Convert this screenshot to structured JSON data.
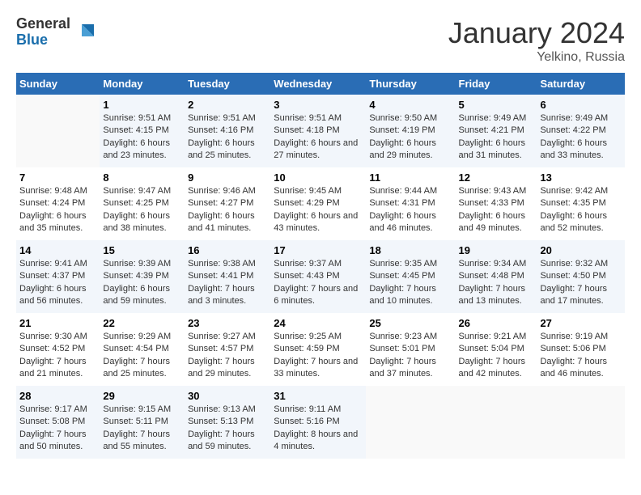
{
  "logo": {
    "general": "General",
    "blue": "Blue"
  },
  "title": "January 2024",
  "subtitle": "Yelkino, Russia",
  "days_header": [
    "Sunday",
    "Monday",
    "Tuesday",
    "Wednesday",
    "Thursday",
    "Friday",
    "Saturday"
  ],
  "weeks": [
    [
      {
        "day": "",
        "sunrise": "",
        "sunset": "",
        "daylight": ""
      },
      {
        "day": "1",
        "sunrise": "Sunrise: 9:51 AM",
        "sunset": "Sunset: 4:15 PM",
        "daylight": "Daylight: 6 hours and 23 minutes."
      },
      {
        "day": "2",
        "sunrise": "Sunrise: 9:51 AM",
        "sunset": "Sunset: 4:16 PM",
        "daylight": "Daylight: 6 hours and 25 minutes."
      },
      {
        "day": "3",
        "sunrise": "Sunrise: 9:51 AM",
        "sunset": "Sunset: 4:18 PM",
        "daylight": "Daylight: 6 hours and 27 minutes."
      },
      {
        "day": "4",
        "sunrise": "Sunrise: 9:50 AM",
        "sunset": "Sunset: 4:19 PM",
        "daylight": "Daylight: 6 hours and 29 minutes."
      },
      {
        "day": "5",
        "sunrise": "Sunrise: 9:49 AM",
        "sunset": "Sunset: 4:21 PM",
        "daylight": "Daylight: 6 hours and 31 minutes."
      },
      {
        "day": "6",
        "sunrise": "Sunrise: 9:49 AM",
        "sunset": "Sunset: 4:22 PM",
        "daylight": "Daylight: 6 hours and 33 minutes."
      }
    ],
    [
      {
        "day": "7",
        "sunrise": "Sunrise: 9:48 AM",
        "sunset": "Sunset: 4:24 PM",
        "daylight": "Daylight: 6 hours and 35 minutes."
      },
      {
        "day": "8",
        "sunrise": "Sunrise: 9:47 AM",
        "sunset": "Sunset: 4:25 PM",
        "daylight": "Daylight: 6 hours and 38 minutes."
      },
      {
        "day": "9",
        "sunrise": "Sunrise: 9:46 AM",
        "sunset": "Sunset: 4:27 PM",
        "daylight": "Daylight: 6 hours and 41 minutes."
      },
      {
        "day": "10",
        "sunrise": "Sunrise: 9:45 AM",
        "sunset": "Sunset: 4:29 PM",
        "daylight": "Daylight: 6 hours and 43 minutes."
      },
      {
        "day": "11",
        "sunrise": "Sunrise: 9:44 AM",
        "sunset": "Sunset: 4:31 PM",
        "daylight": "Daylight: 6 hours and 46 minutes."
      },
      {
        "day": "12",
        "sunrise": "Sunrise: 9:43 AM",
        "sunset": "Sunset: 4:33 PM",
        "daylight": "Daylight: 6 hours and 49 minutes."
      },
      {
        "day": "13",
        "sunrise": "Sunrise: 9:42 AM",
        "sunset": "Sunset: 4:35 PM",
        "daylight": "Daylight: 6 hours and 52 minutes."
      }
    ],
    [
      {
        "day": "14",
        "sunrise": "Sunrise: 9:41 AM",
        "sunset": "Sunset: 4:37 PM",
        "daylight": "Daylight: 6 hours and 56 minutes."
      },
      {
        "day": "15",
        "sunrise": "Sunrise: 9:39 AM",
        "sunset": "Sunset: 4:39 PM",
        "daylight": "Daylight: 6 hours and 59 minutes."
      },
      {
        "day": "16",
        "sunrise": "Sunrise: 9:38 AM",
        "sunset": "Sunset: 4:41 PM",
        "daylight": "Daylight: 7 hours and 3 minutes."
      },
      {
        "day": "17",
        "sunrise": "Sunrise: 9:37 AM",
        "sunset": "Sunset: 4:43 PM",
        "daylight": "Daylight: 7 hours and 6 minutes."
      },
      {
        "day": "18",
        "sunrise": "Sunrise: 9:35 AM",
        "sunset": "Sunset: 4:45 PM",
        "daylight": "Daylight: 7 hours and 10 minutes."
      },
      {
        "day": "19",
        "sunrise": "Sunrise: 9:34 AM",
        "sunset": "Sunset: 4:48 PM",
        "daylight": "Daylight: 7 hours and 13 minutes."
      },
      {
        "day": "20",
        "sunrise": "Sunrise: 9:32 AM",
        "sunset": "Sunset: 4:50 PM",
        "daylight": "Daylight: 7 hours and 17 minutes."
      }
    ],
    [
      {
        "day": "21",
        "sunrise": "Sunrise: 9:30 AM",
        "sunset": "Sunset: 4:52 PM",
        "daylight": "Daylight: 7 hours and 21 minutes."
      },
      {
        "day": "22",
        "sunrise": "Sunrise: 9:29 AM",
        "sunset": "Sunset: 4:54 PM",
        "daylight": "Daylight: 7 hours and 25 minutes."
      },
      {
        "day": "23",
        "sunrise": "Sunrise: 9:27 AM",
        "sunset": "Sunset: 4:57 PM",
        "daylight": "Daylight: 7 hours and 29 minutes."
      },
      {
        "day": "24",
        "sunrise": "Sunrise: 9:25 AM",
        "sunset": "Sunset: 4:59 PM",
        "daylight": "Daylight: 7 hours and 33 minutes."
      },
      {
        "day": "25",
        "sunrise": "Sunrise: 9:23 AM",
        "sunset": "Sunset: 5:01 PM",
        "daylight": "Daylight: 7 hours and 37 minutes."
      },
      {
        "day": "26",
        "sunrise": "Sunrise: 9:21 AM",
        "sunset": "Sunset: 5:04 PM",
        "daylight": "Daylight: 7 hours and 42 minutes."
      },
      {
        "day": "27",
        "sunrise": "Sunrise: 9:19 AM",
        "sunset": "Sunset: 5:06 PM",
        "daylight": "Daylight: 7 hours and 46 minutes."
      }
    ],
    [
      {
        "day": "28",
        "sunrise": "Sunrise: 9:17 AM",
        "sunset": "Sunset: 5:08 PM",
        "daylight": "Daylight: 7 hours and 50 minutes."
      },
      {
        "day": "29",
        "sunrise": "Sunrise: 9:15 AM",
        "sunset": "Sunset: 5:11 PM",
        "daylight": "Daylight: 7 hours and 55 minutes."
      },
      {
        "day": "30",
        "sunrise": "Sunrise: 9:13 AM",
        "sunset": "Sunset: 5:13 PM",
        "daylight": "Daylight: 7 hours and 59 minutes."
      },
      {
        "day": "31",
        "sunrise": "Sunrise: 9:11 AM",
        "sunset": "Sunset: 5:16 PM",
        "daylight": "Daylight: 8 hours and 4 minutes."
      },
      {
        "day": "",
        "sunrise": "",
        "sunset": "",
        "daylight": ""
      },
      {
        "day": "",
        "sunrise": "",
        "sunset": "",
        "daylight": ""
      },
      {
        "day": "",
        "sunrise": "",
        "sunset": "",
        "daylight": ""
      }
    ]
  ]
}
